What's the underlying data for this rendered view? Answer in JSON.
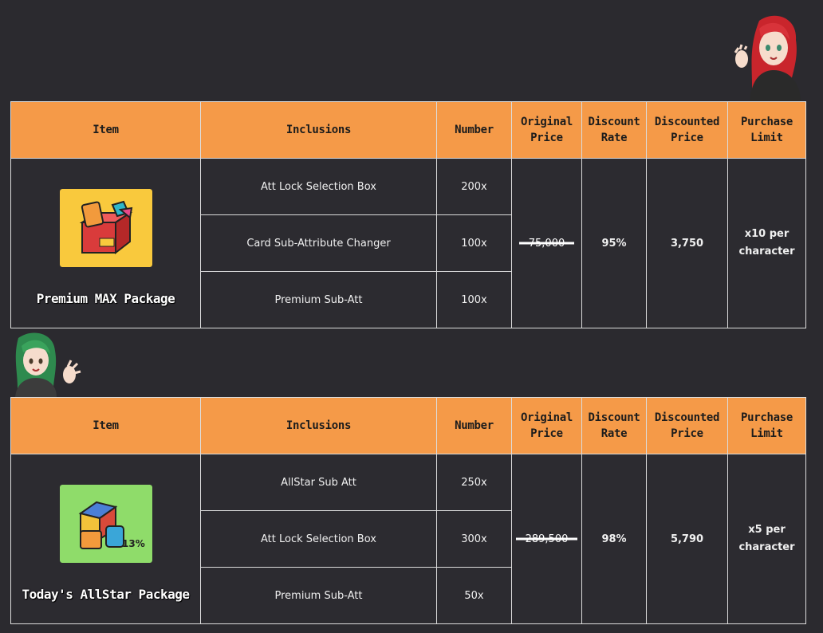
{
  "headers": {
    "item": "Item",
    "inclusions": "Inclusions",
    "number": "Number",
    "original_price": [
      "Original",
      "Price"
    ],
    "discount_rate": [
      "Discount",
      "Rate"
    ],
    "discounted_price": [
      "Discounted",
      "Price"
    ],
    "purchase_limit": [
      "Purchase",
      "Limit"
    ]
  },
  "packages": [
    {
      "name": "Premium MAX Package",
      "icon": "max-package-icon",
      "icon_bg": "#f9c93d",
      "rows": [
        {
          "inclusion": "Att Lock Selection Box",
          "number": "200x"
        },
        {
          "inclusion": "Card Sub-Attribute Changer",
          "number": "100x"
        },
        {
          "inclusion": "Premium Sub-Att",
          "number": "100x"
        }
      ],
      "original_price": "75,000",
      "discount_rate": "95%",
      "discounted_price": "3,750",
      "limit": [
        "x10 per",
        "character"
      ]
    },
    {
      "name": "Today's AllStar Package",
      "icon": "allstar-package-icon",
      "icon_bg": "#8fdc6a",
      "rows": [
        {
          "inclusion": "AllStar Sub Att",
          "number": "250x"
        },
        {
          "inclusion": "Att Lock Selection Box",
          "number": "300x"
        },
        {
          "inclusion": "Premium Sub-Att",
          "number": "50x"
        }
      ],
      "original_price": "289,500",
      "discount_rate": "98%",
      "discounted_price": "5,790",
      "limit": [
        "x5 per",
        "character"
      ]
    }
  ],
  "colors": {
    "background": "#2b2a2f",
    "header": "#f59a48",
    "border": "#dcdcdc"
  }
}
